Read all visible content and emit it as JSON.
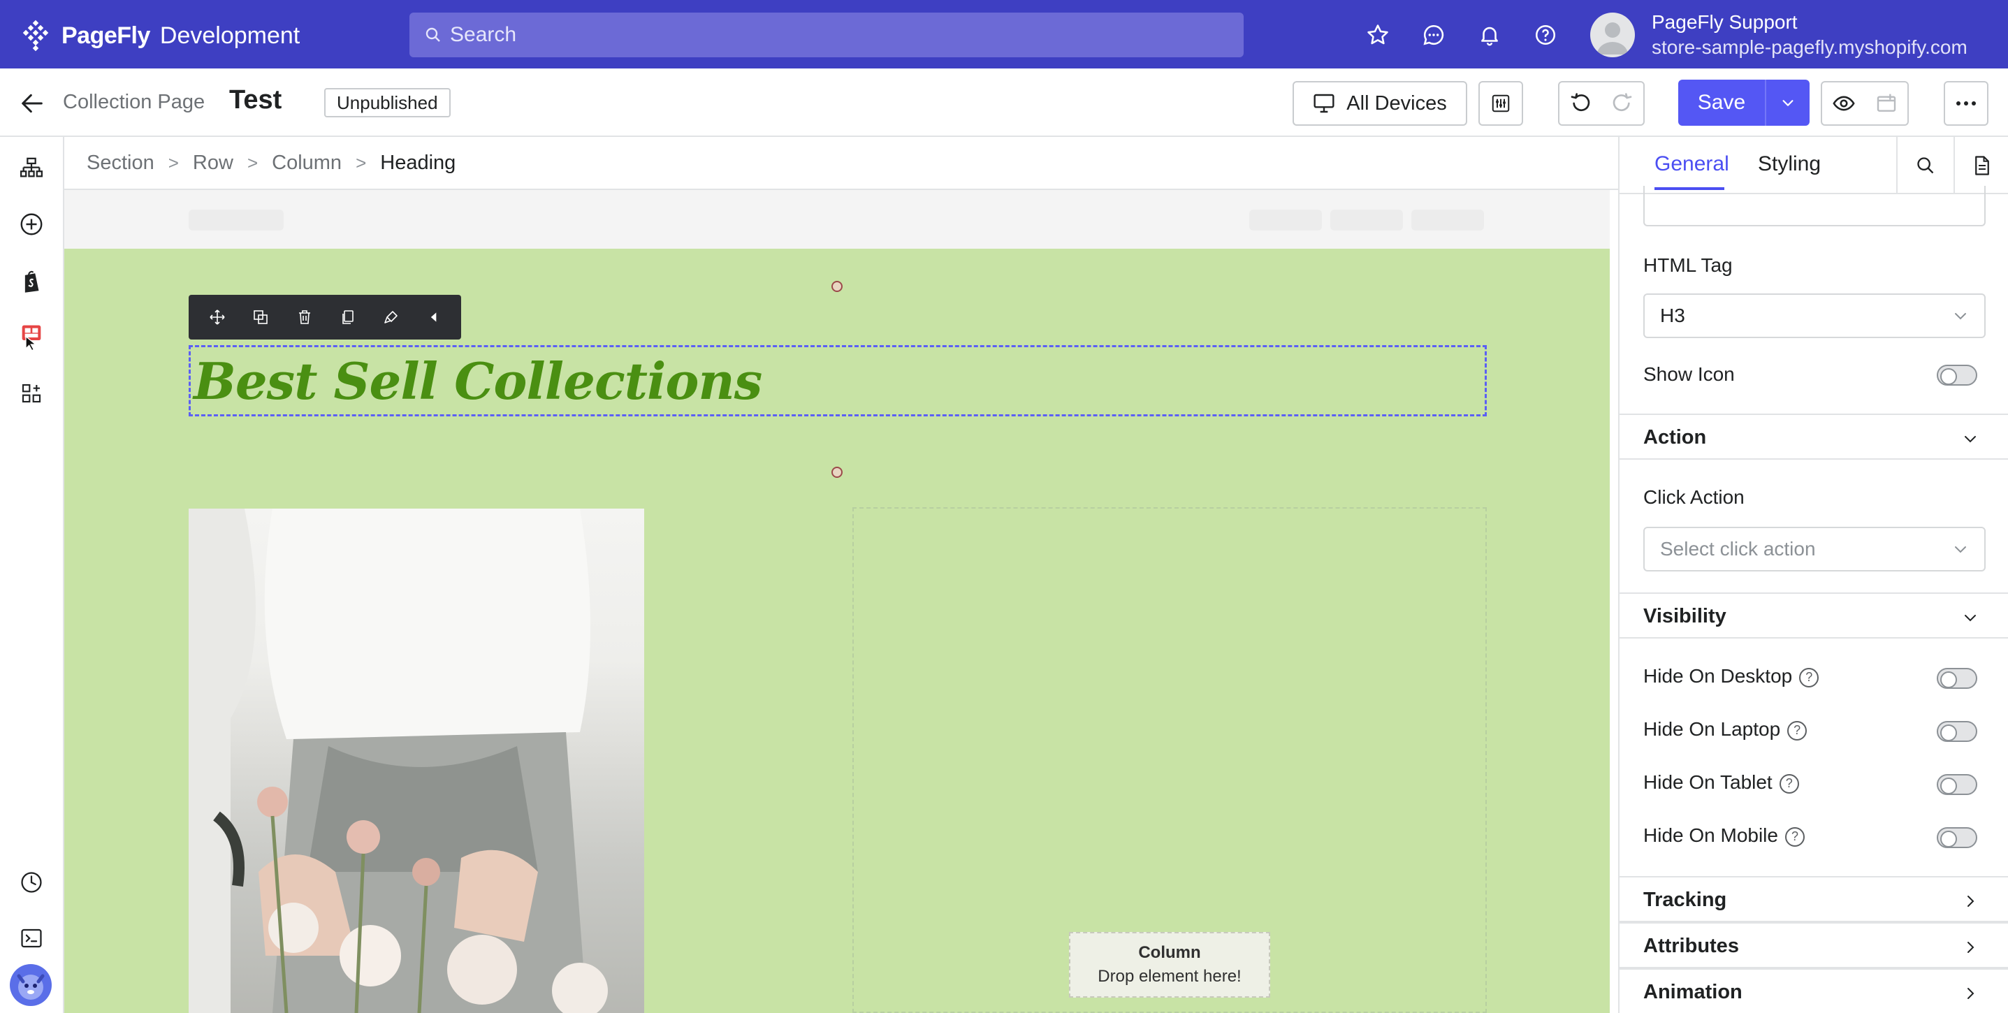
{
  "app": {
    "brand": "PageFly",
    "brand_suffix": "Development",
    "search_placeholder": "Search",
    "user_name": "PageFly Support",
    "user_store": "store-sample-pagefly.myshopify.com"
  },
  "toolbar": {
    "page_type": "Collection Page",
    "page_title": "Test",
    "status": "Unpublished",
    "devices_label": "All Devices",
    "save_label": "Save"
  },
  "breadcrumb": [
    "Section",
    "Row",
    "Column",
    "Heading"
  ],
  "canvas": {
    "heading_text": "Best Sell Collections",
    "drop_title": "Column",
    "drop_subtitle": "Drop element here!"
  },
  "panel": {
    "tabs": [
      "General",
      "Styling"
    ],
    "html_tag_label": "HTML Tag",
    "html_tag_value": "H3",
    "show_icon_label": "Show Icon",
    "action_section": "Action",
    "click_action_label": "Click Action",
    "click_action_placeholder": "Select click action",
    "visibility_section": "Visibility",
    "visibility_items": [
      "Hide On Desktop",
      "Hide On Laptop",
      "Hide On Tablet",
      "Hide On Mobile"
    ],
    "tracking_section": "Tracking",
    "attributes_section": "Attributes",
    "animation_section": "Animation"
  },
  "colors": {
    "topbar": "#3e3fc2",
    "accent": "#5457f4",
    "section_bg": "#c8e3a5",
    "heading": "#4a8f12"
  }
}
